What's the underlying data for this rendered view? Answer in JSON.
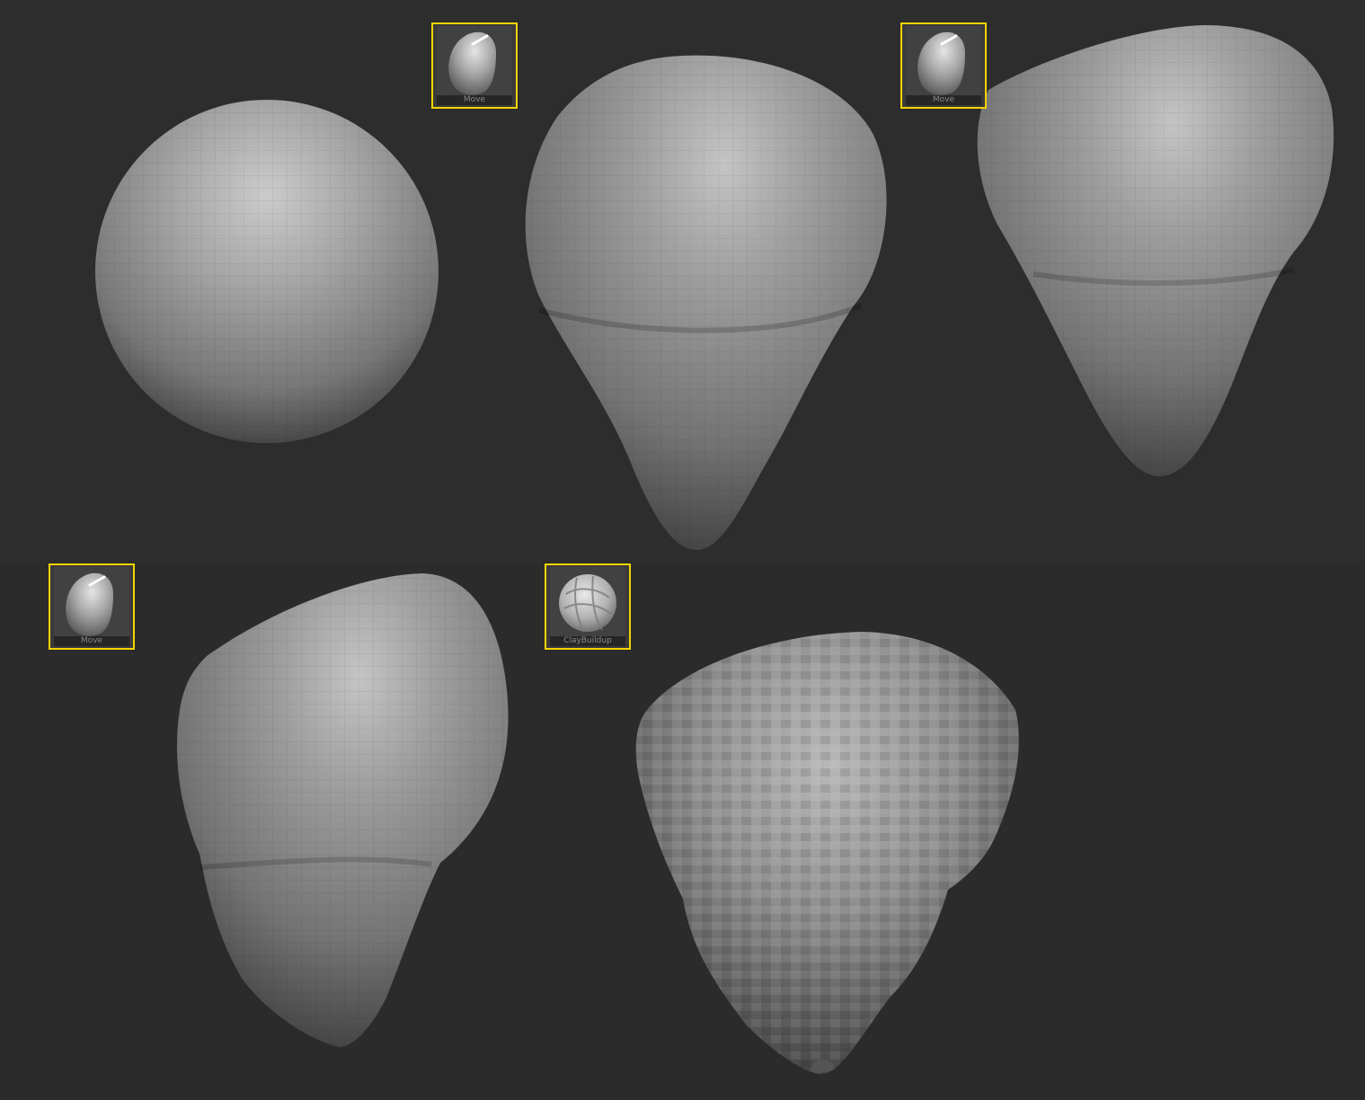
{
  "brushes": [
    {
      "id": "move-1",
      "label": "Move",
      "icon": "move-brush-icon",
      "selected": true
    },
    {
      "id": "move-2",
      "label": "Move",
      "icon": "move-brush-icon",
      "selected": true
    },
    {
      "id": "move-3",
      "label": "Move",
      "icon": "move-brush-icon",
      "selected": true
    },
    {
      "id": "claybuildup",
      "label": "ClayBuildup",
      "icon": "claybuildup-brush-icon",
      "selected": true
    }
  ],
  "colors": {
    "background": "#2c2c2c",
    "highlight": "#f2d400",
    "mesh": "#8c8c8c"
  }
}
